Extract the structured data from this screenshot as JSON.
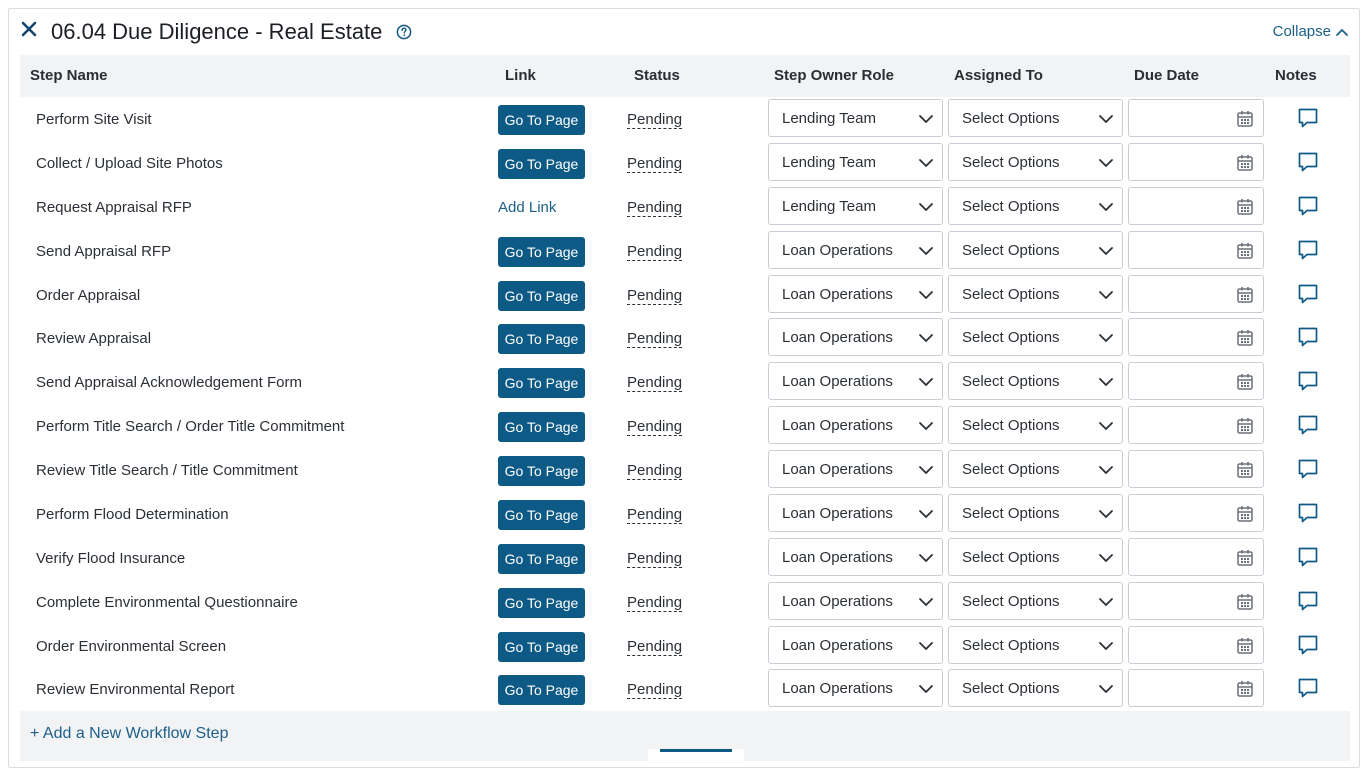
{
  "section": {
    "title": "06.04 Due Diligence - Real Estate",
    "collapse_label": "Collapse"
  },
  "columns": {
    "step_name": "Step Name",
    "link": "Link",
    "status": "Status",
    "owner_role": "Step Owner Role",
    "assigned_to": "Assigned To",
    "due_date": "Due Date",
    "notes": "Notes"
  },
  "rows": [
    {
      "name": "Perform Site Visit",
      "link": "Go To Page",
      "link_type": "button",
      "status": "Pending",
      "role": "Lending Team",
      "assigned": "Select Options",
      "due": ""
    },
    {
      "name": "Collect / Upload Site Photos",
      "link": "Go To Page",
      "link_type": "button",
      "status": "Pending",
      "role": "Lending Team",
      "assigned": "Select Options",
      "due": ""
    },
    {
      "name": "Request Appraisal RFP",
      "link": "Add Link",
      "link_type": "text",
      "status": "Pending",
      "role": "Lending Team",
      "assigned": "Select Options",
      "due": ""
    },
    {
      "name": "Send Appraisal RFP",
      "link": "Go To Page",
      "link_type": "button",
      "status": "Pending",
      "role": "Loan Operations",
      "assigned": "Select Options",
      "due": ""
    },
    {
      "name": "Order Appraisal",
      "link": "Go To Page",
      "link_type": "button",
      "status": "Pending",
      "role": "Loan Operations",
      "assigned": "Select Options",
      "due": ""
    },
    {
      "name": "Review Appraisal",
      "link": "Go To Page",
      "link_type": "button",
      "status": "Pending",
      "role": "Loan Operations",
      "assigned": "Select Options",
      "due": ""
    },
    {
      "name": "Send Appraisal Acknowledgement Form",
      "link": "Go To Page",
      "link_type": "button",
      "status": "Pending",
      "role": "Loan Operations",
      "assigned": "Select Options",
      "due": ""
    },
    {
      "name": "Perform Title Search / Order Title Commitment",
      "link": "Go To Page",
      "link_type": "button",
      "status": "Pending",
      "role": "Loan Operations",
      "assigned": "Select Options",
      "due": ""
    },
    {
      "name": "Review Title Search / Title Commitment",
      "link": "Go To Page",
      "link_type": "button",
      "status": "Pending",
      "role": "Loan Operations",
      "assigned": "Select Options",
      "due": ""
    },
    {
      "name": "Perform Flood Determination",
      "link": "Go To Page",
      "link_type": "button",
      "status": "Pending",
      "role": "Loan Operations",
      "assigned": "Select Options",
      "due": ""
    },
    {
      "name": "Verify Flood Insurance",
      "link": "Go To Page",
      "link_type": "button",
      "status": "Pending",
      "role": "Loan Operations",
      "assigned": "Select Options",
      "due": ""
    },
    {
      "name": "Complete Environmental Questionnaire",
      "link": "Go To Page",
      "link_type": "button",
      "status": "Pending",
      "role": "Loan Operations",
      "assigned": "Select Options",
      "due": ""
    },
    {
      "name": "Order Environmental Screen",
      "link": "Go To Page",
      "link_type": "button",
      "status": "Pending",
      "role": "Loan Operations",
      "assigned": "Select Options",
      "due": ""
    },
    {
      "name": "Review Environmental Report",
      "link": "Go To Page",
      "link_type": "button",
      "status": "Pending",
      "role": "Loan Operations",
      "assigned": "Select Options",
      "due": ""
    }
  ],
  "footer": {
    "add_step_label": "+ Add a New Workflow Step"
  },
  "colors": {
    "accent": "#0d5a86",
    "link": "#1d5f8a",
    "header_bg": "#f1f3f5"
  },
  "icons": {
    "close": "close-icon",
    "help": "help-circle-icon",
    "collapse": "chevron-up-icon",
    "dropdown": "chevron-down-icon",
    "date": "calendar-icon",
    "notes": "speech-bubble-icon"
  }
}
